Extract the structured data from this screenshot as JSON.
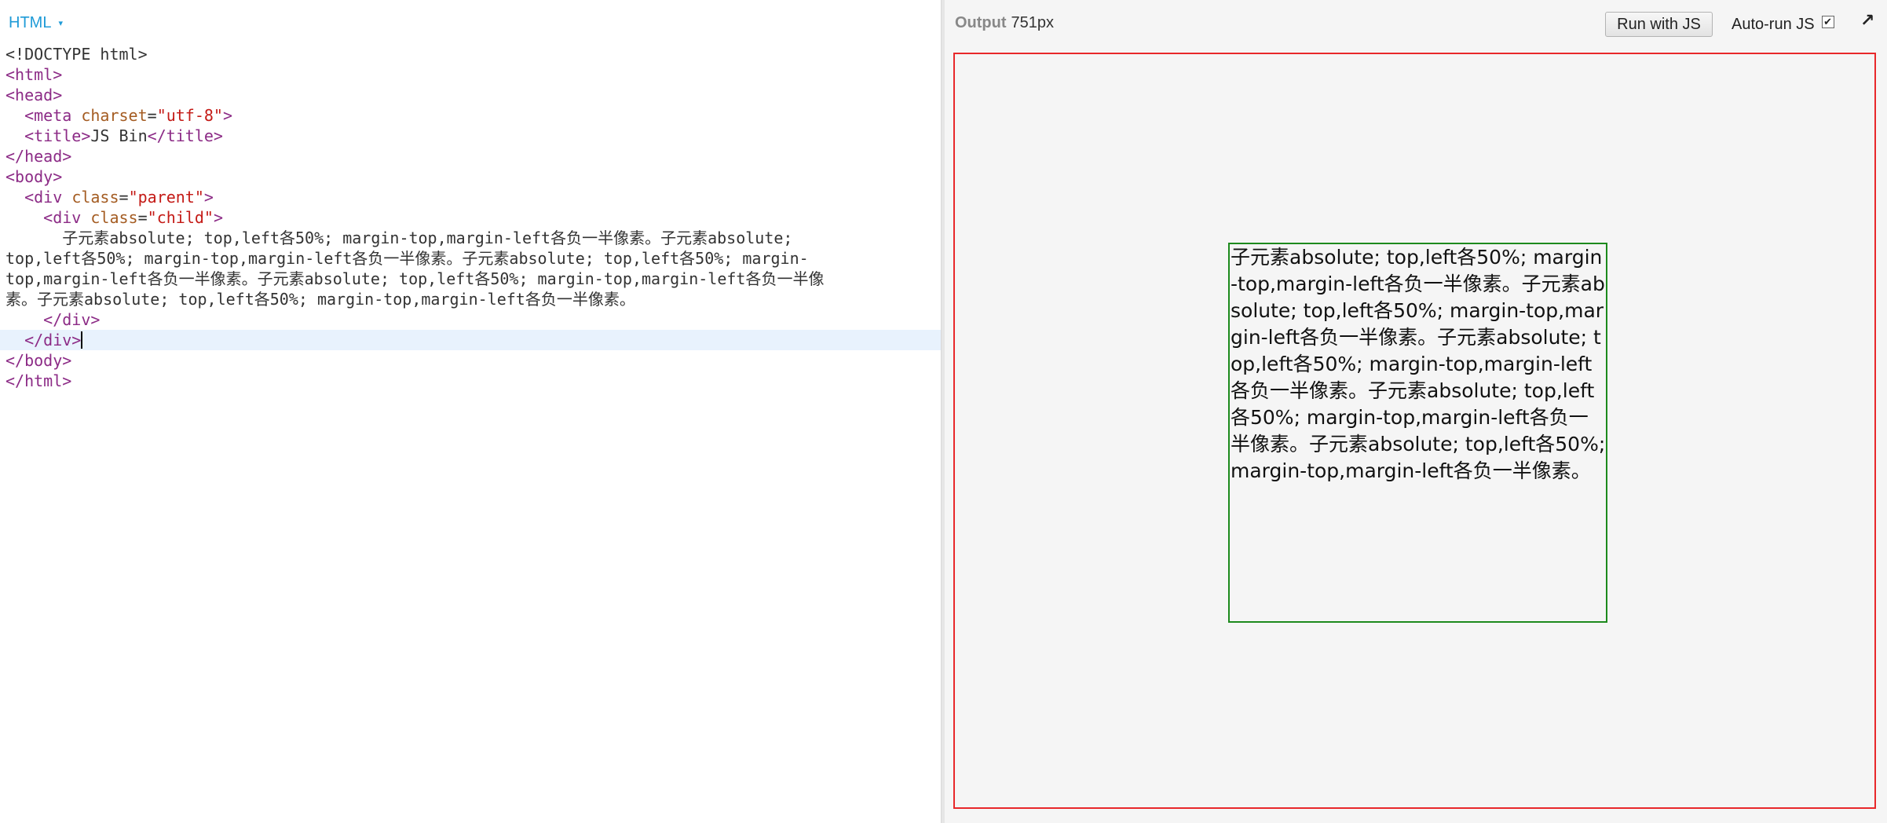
{
  "editor": {
    "tab_label": "HTML",
    "tab_caret": "▾",
    "lines": [
      {
        "indent": "",
        "parts": [
          [
            "plain",
            "<!DOCTYPE html>"
          ]
        ]
      },
      {
        "indent": "",
        "parts": [
          [
            "tag",
            "<html>"
          ]
        ]
      },
      {
        "indent": "",
        "parts": [
          [
            "tag",
            "<head>"
          ]
        ]
      },
      {
        "indent": "  ",
        "parts": [
          [
            "tag",
            "<meta "
          ],
          [
            "attr",
            "charset"
          ],
          [
            "plain",
            "="
          ],
          [
            "str",
            "\"utf-8\""
          ],
          [
            "tag",
            ">"
          ]
        ]
      },
      {
        "indent": "  ",
        "parts": [
          [
            "tag",
            "<title>"
          ],
          [
            "plain",
            "JS Bin"
          ],
          [
            "tag",
            "</title>"
          ]
        ]
      },
      {
        "indent": "",
        "parts": [
          [
            "tag",
            "</head>"
          ]
        ]
      },
      {
        "indent": "",
        "parts": [
          [
            "tag",
            "<body>"
          ]
        ]
      },
      {
        "indent": "  ",
        "parts": [
          [
            "tag",
            "<div "
          ],
          [
            "attr",
            "class"
          ],
          [
            "plain",
            "="
          ],
          [
            "str",
            "\"parent\""
          ],
          [
            "tag",
            ">"
          ]
        ]
      },
      {
        "indent": "    ",
        "parts": [
          [
            "tag",
            "<div "
          ],
          [
            "attr",
            "class"
          ],
          [
            "plain",
            "="
          ],
          [
            "str",
            "\"child\""
          ],
          [
            "tag",
            ">"
          ]
        ]
      },
      {
        "indent": "      ",
        "parts": [
          [
            "plain",
            "子元素absolute; top,left各50%; margin-top,margin-left各负一半像素。子元素absolute;"
          ]
        ]
      },
      {
        "indent": "",
        "parts": [
          [
            "plain",
            "top,left各50%; margin-top,margin-left各负一半像素。子元素absolute; top,left各50%; margin-"
          ]
        ]
      },
      {
        "indent": "",
        "parts": [
          [
            "plain",
            "top,margin-left各负一半像素。子元素absolute; top,left各50%; margin-top,margin-left各负一半像"
          ]
        ]
      },
      {
        "indent": "",
        "parts": [
          [
            "plain",
            "素。子元素absolute; top,left各50%; margin-top,margin-left各负一半像素。"
          ]
        ]
      },
      {
        "indent": "    ",
        "parts": [
          [
            "tag",
            "</div>"
          ]
        ]
      },
      {
        "indent": "  ",
        "parts": [
          [
            "tag",
            "</div>"
          ]
        ],
        "active": true,
        "cursor": true
      },
      {
        "indent": "",
        "parts": [
          [
            "tag",
            "</body>"
          ]
        ]
      },
      {
        "indent": "",
        "parts": [
          [
            "tag",
            "</html>"
          ]
        ]
      }
    ]
  },
  "output": {
    "label": "Output",
    "width_text": "751px",
    "run_button": "Run with JS",
    "autorun_label": "Auto-run JS",
    "autorun_checked": "✔",
    "popout_icon": "↗",
    "child_text": "子元素absolute; top,left各50%; margin-top,margin-left各负一半像素。子元素absolute; top,left各50%; margin-top,margin-left各负一半像素。子元素absolute; top,left各50%; margin-top,margin-left各负一半像素。子元素absolute; top,left各50%; margin-top,margin-left各负一半像素。子元素absolute; top,left各50%; margin-top,margin-left各负一半像素。"
  },
  "colors": {
    "parent_border": "#e8282a",
    "child_border": "#1d8a1d",
    "tab_accent": "#1f9bd7"
  }
}
